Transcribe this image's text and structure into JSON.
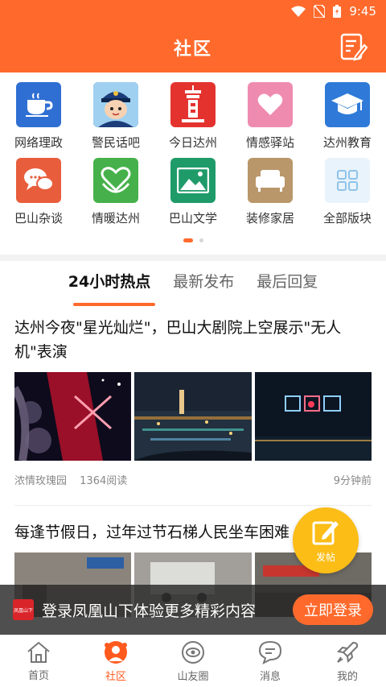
{
  "status_bar": {
    "time": "9:45"
  },
  "header": {
    "title": "社区"
  },
  "categories": [
    {
      "label": "网络理政",
      "icon": "teacup-icon",
      "color": "#2f6fd3"
    },
    {
      "label": "警民话吧",
      "icon": "police-avatar-icon",
      "color": "#1e4fa0"
    },
    {
      "label": "今日达州",
      "icon": "tower-icon",
      "color": "#e4332e"
    },
    {
      "label": "情感驿站",
      "icon": "heart-icon",
      "color": "#f08bb0"
    },
    {
      "label": "达州教育",
      "icon": "graduation-cap-icon",
      "color": "#2f7ad8"
    },
    {
      "label": "巴山杂谈",
      "icon": "chat-bubbles-icon",
      "color": "#e85d3b"
    },
    {
      "label": "情暖达州",
      "icon": "heart-hands-icon",
      "color": "#46b14a"
    },
    {
      "label": "巴山文学",
      "icon": "landscape-icon",
      "color": "#1f9b6a"
    },
    {
      "label": "装修家居",
      "icon": "sofa-icon",
      "color": "#b9976a"
    },
    {
      "label": "全部版块",
      "icon": "grid-icon",
      "color": "#e8f3fb"
    }
  ],
  "tabs": [
    {
      "label": "24小时热点",
      "active": true
    },
    {
      "label": "最新发布",
      "active": false
    },
    {
      "label": "最后回复",
      "active": false
    }
  ],
  "posts": [
    {
      "title": "达州今夜\"星光灿烂\"，巴山大剧院上空展示\"无人机\"表演",
      "author": "浓情玫瑰园",
      "reads": "1364阅读",
      "time": "9分钟前"
    },
    {
      "title": "每逢节假日，过年过节石梯人民坐车困难"
    }
  ],
  "fab": {
    "label": "发帖"
  },
  "login_banner": {
    "logo_text": "凤凰山下",
    "text": "登录凤凰山下体验更多精彩内容",
    "button": "立即登录"
  },
  "bottom_nav": [
    {
      "label": "首页",
      "icon": "home-icon",
      "active": false
    },
    {
      "label": "社区",
      "icon": "community-icon",
      "active": true
    },
    {
      "label": "山友圈",
      "icon": "circle-eye-icon",
      "active": false
    },
    {
      "label": "消息",
      "icon": "message-icon",
      "active": false
    },
    {
      "label": "我的",
      "icon": "rocket-icon",
      "active": false
    }
  ],
  "colors": {
    "accent": "#ff6a2c",
    "fab": "#fbbd16"
  }
}
